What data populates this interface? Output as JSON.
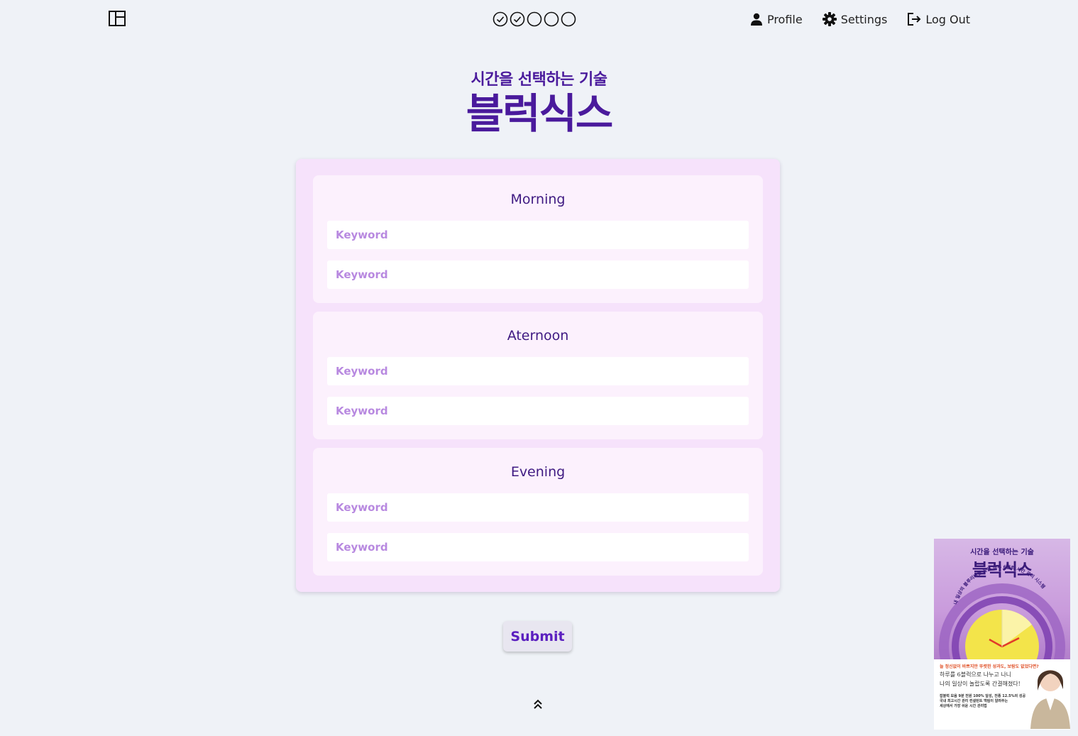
{
  "topbar": {
    "layout_toggle_icon": "layout-panel-icon",
    "progress": [
      {
        "icon": "check-circle-icon",
        "done": true
      },
      {
        "icon": "check-circle-icon",
        "done": true
      },
      {
        "icon": "empty-circle-icon",
        "done": false
      },
      {
        "icon": "empty-circle-icon",
        "done": false
      },
      {
        "icon": "empty-circle-icon",
        "done": false
      }
    ],
    "nav": {
      "profile": {
        "label": "Profile",
        "icon": "person-icon"
      },
      "settings": {
        "label": "Settings",
        "icon": "gear-icon"
      },
      "logout": {
        "label": "Log Out",
        "icon": "logout-icon"
      }
    }
  },
  "header": {
    "subtitle": "시간을 선택하는 기술",
    "title": "블럭식스"
  },
  "form": {
    "sections": [
      {
        "title": "Morning",
        "inputs": [
          {
            "placeholder": "Keyword",
            "value": ""
          },
          {
            "placeholder": "Keyword",
            "value": ""
          }
        ]
      },
      {
        "title": "Aternoon",
        "inputs": [
          {
            "placeholder": "Keyword",
            "value": ""
          },
          {
            "placeholder": "Keyword",
            "value": ""
          }
        ]
      },
      {
        "title": "Evening",
        "inputs": [
          {
            "placeholder": "Keyword",
            "value": ""
          },
          {
            "placeholder": "Keyword",
            "value": ""
          }
        ]
      }
    ],
    "submit_label": "Submit"
  },
  "scroll_top_icon": "double-chevron-up-icon",
  "book_ad": {
    "subtitle": "시간을 선택하는 기술",
    "title": "블럭식스",
    "arc_text": "내 일상의 블루리버를 찾는 하루 6블럭 시간 관리 시스템",
    "headline": "늘 정신없이 바쁘지만 뚜렷한 성과도, 보람도 없었다면?",
    "line1": "하루를 6블럭으로 나누고 나니",
    "line2": "나의 일상이 놀랍도록 간결해졌다!",
    "small1": "잡블럭 모음 9분 전원 100% 달성, 전종 12.5%의 성공",
    "small2": "국내 최고시간 관리 컨설턴트 백림이 알려주는",
    "small3": "세상에서 가장 쉬운 시간 관리법",
    "colors": {
      "accent": "#3a1a7a",
      "clock": "#f3e44a",
      "hand": "#e23a2a"
    }
  },
  "colors": {
    "background": "#eff2f7",
    "brand": "#4a1a9c",
    "card": "#f6e2fb",
    "section": "#fcf1fd",
    "placeholder": "#b889e0",
    "submit_text": "#5b1fbf"
  }
}
